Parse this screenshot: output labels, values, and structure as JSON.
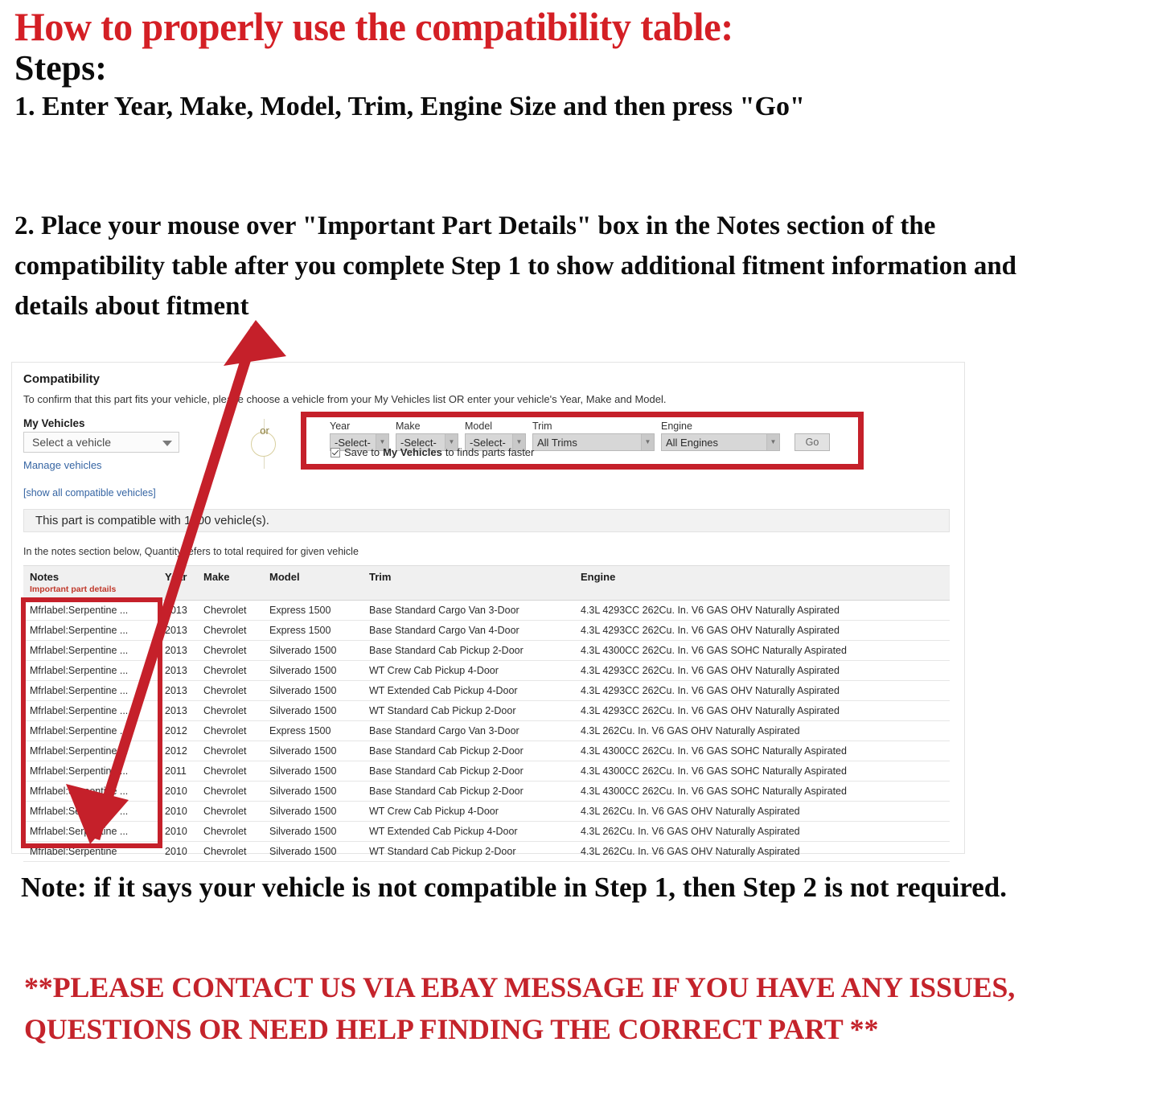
{
  "headline": {
    "title": "How to properly use the compatibility table:",
    "steps_label": "Steps:",
    "step_one": "1. Enter Year, Make, Model, Trim, Engine Size and then press \"Go\"",
    "step_two": "2. Place your mouse over \"Important Part Details\" box in the Notes section of the compatibility table after you complete Step 1 to show additional fitment information and details about fitment"
  },
  "compatibility": {
    "heading": "Compatibility",
    "subtext": "To confirm that this part fits your vehicle, please choose a vehicle from your My Vehicles list OR enter your vehicle's Year, Make and Model.",
    "my_vehicles_label": "My Vehicles",
    "my_vehicles_value": "Select a vehicle",
    "manage_vehicles_link": "Manage vehicles",
    "show_all_link": "[show all compatible vehicles]",
    "or_divider": "or",
    "selectors": [
      {
        "label": "Year",
        "value": "-Select-"
      },
      {
        "label": "Make",
        "value": "-Select-"
      },
      {
        "label": "Model",
        "value": "-Select-"
      },
      {
        "label": "Trim",
        "value": "All Trims"
      },
      {
        "label": "Engine",
        "value": "All Engines"
      }
    ],
    "go_label": "Go",
    "save_prefix": "Save to",
    "save_bold": "My Vehicles",
    "save_suffix": "to finds parts faster",
    "compat_message": "This part is compatible with 1000 vehicle(s).",
    "notes_hint": "In the notes section below, Quantity refers to total required for given vehicle",
    "accent_red": "#c5202a",
    "title_red": "#d41f25",
    "link_blue": "#3665a3"
  },
  "table": {
    "headers": [
      "Notes",
      "Year",
      "Make",
      "Model",
      "Trim",
      "Engine"
    ],
    "notes_subheader": "Important part details",
    "rows": [
      {
        "notes": "Mfrlabel:Serpentine ...",
        "year": "2013",
        "make": "Chevrolet",
        "model": "Express 1500",
        "trim": "Base Standard Cargo Van 3-Door",
        "engine": "4.3L 4293CC 262Cu. In. V6 GAS OHV Naturally Aspirated"
      },
      {
        "notes": "Mfrlabel:Serpentine ...",
        "year": "2013",
        "make": "Chevrolet",
        "model": "Express 1500",
        "trim": "Base Standard Cargo Van 4-Door",
        "engine": "4.3L 4293CC 262Cu. In. V6 GAS OHV Naturally Aspirated"
      },
      {
        "notes": "Mfrlabel:Serpentine ...",
        "year": "2013",
        "make": "Chevrolet",
        "model": "Silverado 1500",
        "trim": "Base Standard Cab Pickup 2-Door",
        "engine": "4.3L 4300CC 262Cu. In. V6 GAS SOHC Naturally Aspirated"
      },
      {
        "notes": "Mfrlabel:Serpentine ...",
        "year": "2013",
        "make": "Chevrolet",
        "model": "Silverado 1500",
        "trim": "WT Crew Cab Pickup 4-Door",
        "engine": "4.3L 4293CC 262Cu. In. V6 GAS OHV Naturally Aspirated"
      },
      {
        "notes": "Mfrlabel:Serpentine ...",
        "year": "2013",
        "make": "Chevrolet",
        "model": "Silverado 1500",
        "trim": "WT Extended Cab Pickup 4-Door",
        "engine": "4.3L 4293CC 262Cu. In. V6 GAS OHV Naturally Aspirated"
      },
      {
        "notes": "Mfrlabel:Serpentine ...",
        "year": "2013",
        "make": "Chevrolet",
        "model": "Silverado 1500",
        "trim": "WT Standard Cab Pickup 2-Door",
        "engine": "4.3L 4293CC 262Cu. In. V6 GAS OHV Naturally Aspirated"
      },
      {
        "notes": "Mfrlabel:Serpentine ...",
        "year": "2012",
        "make": "Chevrolet",
        "model": "Express 1500",
        "trim": "Base Standard Cargo Van 3-Door",
        "engine": "4.3L 262Cu. In. V6 GAS OHV Naturally Aspirated"
      },
      {
        "notes": "Mfrlabel:Serpentine ...",
        "year": "2012",
        "make": "Chevrolet",
        "model": "Silverado 1500",
        "trim": "Base Standard Cab Pickup 2-Door",
        "engine": "4.3L 4300CC 262Cu. In. V6 GAS SOHC Naturally Aspirated"
      },
      {
        "notes": "Mfrlabel:Serpentine ...",
        "year": "2011",
        "make": "Chevrolet",
        "model": "Silverado 1500",
        "trim": "Base Standard Cab Pickup 2-Door",
        "engine": "4.3L 4300CC 262Cu. In. V6 GAS SOHC Naturally Aspirated"
      },
      {
        "notes": "Mfrlabel:Serpentine ...",
        "year": "2010",
        "make": "Chevrolet",
        "model": "Silverado 1500",
        "trim": "Base Standard Cab Pickup 2-Door",
        "engine": "4.3L 4300CC 262Cu. In. V6 GAS SOHC Naturally Aspirated"
      },
      {
        "notes": "Mfrlabel:Serpentine ...",
        "year": "2010",
        "make": "Chevrolet",
        "model": "Silverado 1500",
        "trim": "WT Crew Cab Pickup 4-Door",
        "engine": "4.3L 262Cu. In. V6 GAS OHV Naturally Aspirated"
      },
      {
        "notes": "Mfrlabel:Serpentine ...",
        "year": "2010",
        "make": "Chevrolet",
        "model": "Silverado 1500",
        "trim": "WT Extended Cab Pickup 4-Door",
        "engine": "4.3L 262Cu. In. V6 GAS OHV Naturally Aspirated"
      },
      {
        "notes": "Mfrlabel:Serpentine",
        "year": "2010",
        "make": "Chevrolet",
        "model": "Silverado 1500",
        "trim": "WT Standard Cab Pickup 2-Door",
        "engine": "4.3L 262Cu. In. V6 GAS OHV Naturally Aspirated"
      }
    ]
  },
  "footer": {
    "note": "Note: if it says your vehicle is not compatible in Step 1, then Step 2 is not required.",
    "contact": "**PLEASE CONTACT US VIA EBAY MESSAGE IF YOU HAVE ANY ISSUES, QUESTIONS OR NEED HELP FINDING THE CORRECT PART **"
  }
}
